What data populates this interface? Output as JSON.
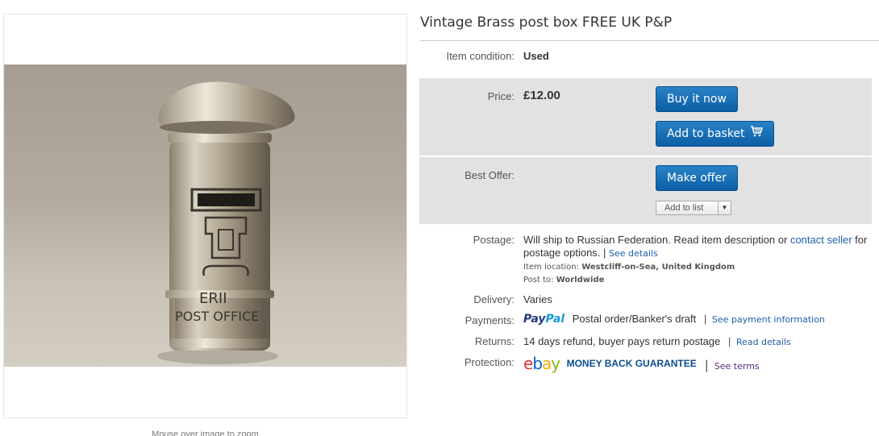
{
  "listing": {
    "title": "Vintage Brass post box FREE UK P&P",
    "image_hint": "Mouse over image to zoom",
    "photo_text_1": "ERII",
    "photo_text_2": "POST OFFICE"
  },
  "condition": {
    "label": "Item condition:",
    "value": "Used"
  },
  "price": {
    "label": "Price:",
    "value": "£12.00"
  },
  "buttons": {
    "buy_now": "Buy it now",
    "add_basket": "Add to basket",
    "make_offer": "Make offer",
    "add_list": "Add to list"
  },
  "best_offer": {
    "label": "Best Offer:"
  },
  "postage": {
    "label": "Postage:",
    "text_1": "Will ship to Russian Federation. Read item description or",
    "contact_link": "contact seller",
    "text_2": "for postage options.",
    "see_details": "See details",
    "item_location_label": "Item location:",
    "item_location": "Westcliff-on-Sea, United Kingdom",
    "post_to_label": "Post to:",
    "post_to": "Worldwide"
  },
  "delivery": {
    "label": "Delivery:",
    "value": "Varies"
  },
  "payments": {
    "label": "Payments:",
    "paypal_1": "Pay",
    "paypal_2": "Pal",
    "other": "Postal order/Banker's draft",
    "link": "See payment information"
  },
  "returns": {
    "label": "Returns:",
    "value": "14 days refund, buyer pays return postage",
    "link": "Read details"
  },
  "protection": {
    "label": "Protection:",
    "ebay_e": "e",
    "ebay_b": "b",
    "ebay_a": "a",
    "ebay_y": "y",
    "guarantee": "MONEY BACK GUARANTEE",
    "link": "See terms"
  },
  "colors": {
    "button_blue": "#0b5fa5",
    "link_blue": "#1e5eaa",
    "panel_gray": "#e2e2e2"
  }
}
